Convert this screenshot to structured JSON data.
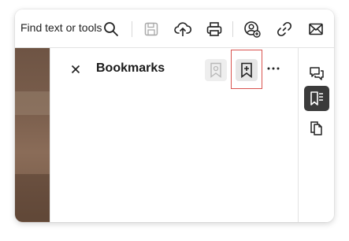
{
  "toolbar": {
    "find_label": "Find text or tools",
    "icons": [
      "search-icon",
      "save-icon",
      "upload-icon",
      "print-icon",
      "account-icon",
      "link-icon",
      "email-icon"
    ]
  },
  "panel": {
    "title": "Bookmarks",
    "actions": [
      "add-bookmark-from-selection-icon",
      "add-bookmark-icon",
      "more-options-icon"
    ]
  },
  "right_rail": {
    "items": [
      "comments-icon",
      "bookmarks-icon",
      "pages-icon"
    ],
    "active": "bookmarks-icon"
  },
  "colors": {
    "highlight": "#d9534f",
    "rail_active": "#3b3b3b"
  }
}
